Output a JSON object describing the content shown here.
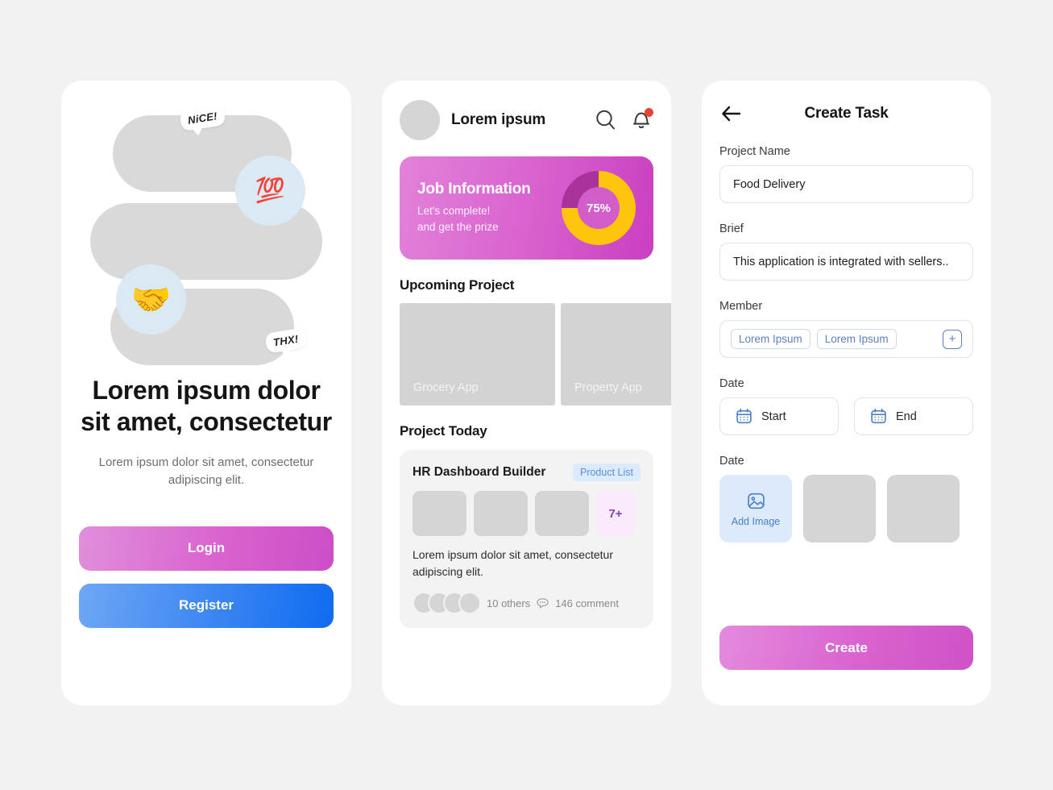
{
  "onboarding": {
    "illustration": {
      "bubble_nice": "NiCE!",
      "bubble_thx": "THX!",
      "emoji_hundred": "💯",
      "emoji_handshake": "🤝"
    },
    "title": "Lorem ipsum dolor sit amet, consectetur",
    "subtitle": "Lorem ipsum dolor sit amet, consectetur adipiscing elit.",
    "login_label": "Login",
    "register_label": "Register",
    "login_gradient": [
      "#e08fdb",
      "#cc4ec6"
    ],
    "register_gradient": [
      "#6ea7f5",
      "#0f6bf0"
    ]
  },
  "home": {
    "user_name": "Lorem ipsum",
    "search_icon": "search-icon",
    "bell_icon": "bell-icon",
    "has_notification": true,
    "job_card": {
      "title": "Job Information",
      "line1": "Let's complete!",
      "line2": "and get the prize",
      "progress_label": "75%",
      "progress_value": 75,
      "arc_color": "#ffc40c",
      "track_color": "#a8339b",
      "gradient": [
        "#e282d9",
        "#c93fc0"
      ]
    },
    "upcoming_title": "Upcoming Project",
    "upcoming_projects": [
      {
        "label": "Grocery App"
      },
      {
        "label": "Property App"
      }
    ],
    "today_title": "Project Today",
    "today_card": {
      "title": "HR Dashboard Builder",
      "chip": "Product List",
      "more_count": "7+",
      "description": "Lorem ipsum dolor sit amet, consectetur adipiscing elit.",
      "others": "10 others",
      "comments": "146 comment",
      "avatar_count": 4,
      "thumb_count": 3
    }
  },
  "create_task": {
    "back_icon": "arrow-left-icon",
    "title": "Create Task",
    "project_name_label": "Project Name",
    "project_name_value": "Food Delivery",
    "brief_label": "Brief",
    "brief_value": "This application is integrated with sellers..",
    "member_label": "Member",
    "members": [
      "Lorem Ipsum",
      "Lorem Ipsum"
    ],
    "add_member_icon": "plus-icon",
    "date_label": "Date",
    "date_start_label": "Start",
    "date_end_label": "End",
    "images_label": "Date",
    "add_image_label": "Add Image",
    "image_slot_count": 2,
    "create_label": "Create",
    "accent_blue": "#5b82bd"
  }
}
